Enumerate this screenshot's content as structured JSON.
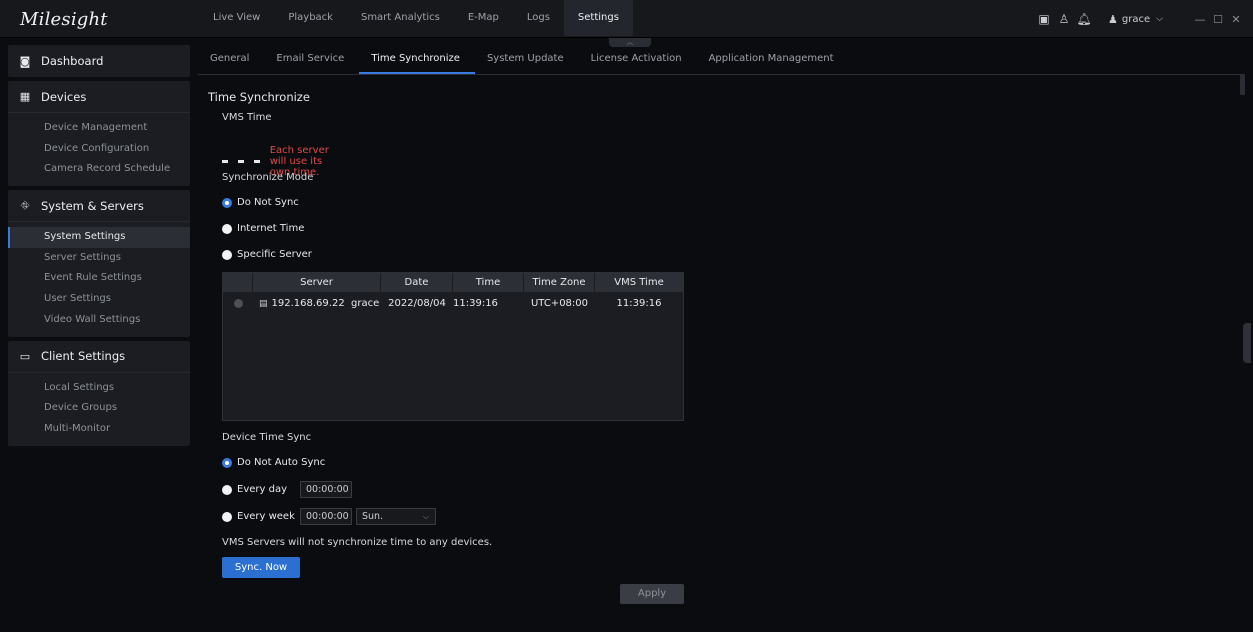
{
  "app": {
    "logo": "Milesight"
  },
  "topnav": {
    "tabs": [
      "Live View",
      "Playback",
      "Smart Analytics",
      "E-Map",
      "Logs",
      "Settings"
    ],
    "active": "Settings"
  },
  "user": {
    "name": "grace"
  },
  "sidebar": {
    "dashboard": "Dashboard",
    "devices": {
      "title": "Devices",
      "items": [
        "Device Management",
        "Device Configuration",
        "Camera Record Schedule"
      ]
    },
    "system": {
      "title": "System & Servers",
      "items": [
        "System Settings",
        "Server Settings",
        "Event Rule Settings",
        "User Settings",
        "Video Wall Settings"
      ]
    },
    "client": {
      "title": "Client Settings",
      "items": [
        "Local Settings",
        "Device Groups",
        "Multi-Monitor"
      ]
    }
  },
  "subtabs": [
    "General",
    "Email Service",
    "Time Synchronize",
    "System Update",
    "License Activation",
    "Application Management"
  ],
  "page": {
    "title": "Time Synchronize",
    "vms_time_label": "VMS Time",
    "vms_time_note": "Each server will use its own time.",
    "sync_mode_label": "Synchronize Mode",
    "sync_modes": [
      "Do Not Sync",
      "Internet Time",
      "Specific Server"
    ],
    "sync_mode_selected": "Do Not Sync",
    "table": {
      "columns": [
        "Server",
        "Date",
        "Time",
        "Time Zone",
        "VMS Time"
      ],
      "rows": [
        {
          "server": "192.168.69.22  grace",
          "date": "2022/08/04",
          "time": "11:39:16",
          "zone": "UTC+08:00",
          "vms_time": "11:39:16"
        }
      ]
    },
    "device_sync_label": "Device Time Sync",
    "device_sync": {
      "none": "Do Not Auto Sync",
      "day": "Every day",
      "week": "Every week",
      "day_time": "00:00:00",
      "week_time": "00:00:00",
      "week_day": "Sun."
    },
    "device_sync_note": "VMS Servers will not synchronize time to any devices.",
    "sync_now": "Sync. Now",
    "apply": "Apply"
  }
}
